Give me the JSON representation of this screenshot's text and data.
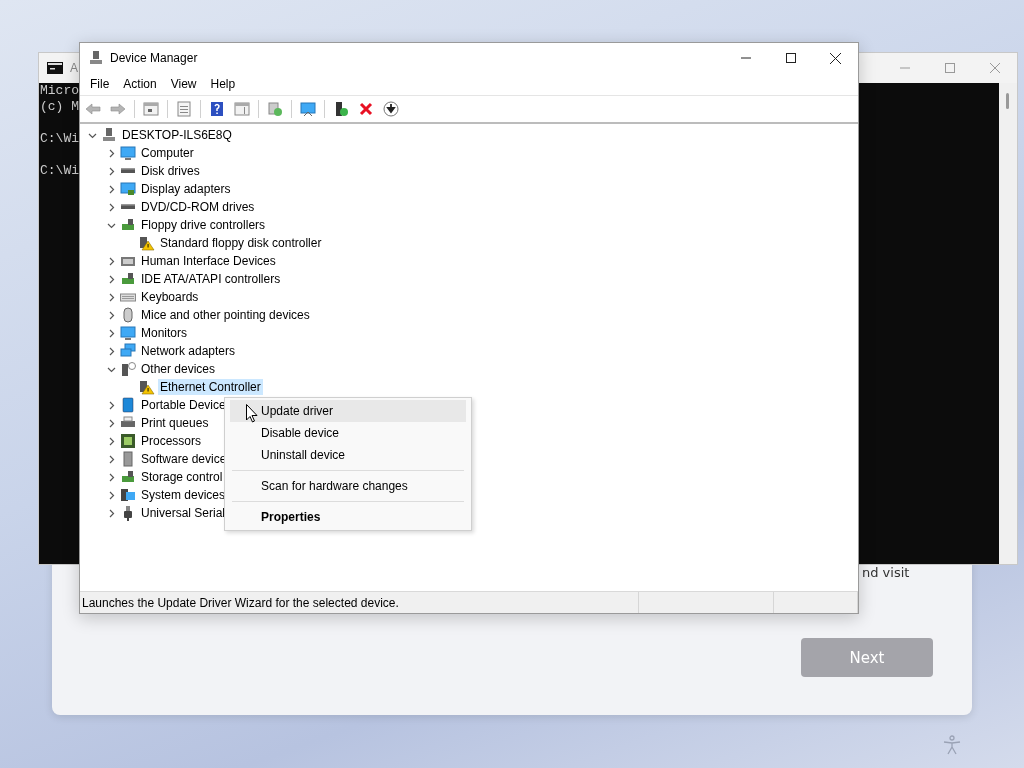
{
  "setup_dialog": {
    "visible_text": "nd visit",
    "next_button": {
      "label": "Next",
      "disabled": true
    }
  },
  "console_window": {
    "title": "A",
    "blocks": [
      [
        "Micro",
        "(c) M"
      ],
      [
        "C:\\Wi"
      ],
      [
        "C:\\Wi"
      ]
    ]
  },
  "device_manager": {
    "title": "Device Manager",
    "menu": [
      "File",
      "Action",
      "View",
      "Help"
    ],
    "tree": {
      "label": "DESKTOP-ILS6E8Q",
      "kind": "computer-root",
      "expanded": true,
      "selected": false,
      "children": [
        {
          "label": "Computer",
          "kind": "monitor",
          "expanded": false,
          "selected": false
        },
        {
          "label": "Disk drives",
          "kind": "drive",
          "expanded": false,
          "selected": false
        },
        {
          "label": "Display adapters",
          "kind": "display",
          "expanded": false,
          "selected": false
        },
        {
          "label": "DVD/CD-ROM drives",
          "kind": "drive",
          "expanded": false,
          "selected": false
        },
        {
          "label": "Floppy drive controllers",
          "kind": "controller",
          "expanded": true,
          "selected": false,
          "children": [
            {
              "label": "Standard floppy disk controller",
              "kind": "warning",
              "selected": false
            }
          ]
        },
        {
          "label": "Human Interface Devices",
          "kind": "hid",
          "expanded": false,
          "selected": false
        },
        {
          "label": "IDE ATA/ATAPI controllers",
          "kind": "controller",
          "expanded": false,
          "selected": false
        },
        {
          "label": "Keyboards",
          "kind": "keyboard",
          "expanded": false,
          "selected": false
        },
        {
          "label": "Mice and other pointing devices",
          "kind": "mouse",
          "expanded": false,
          "selected": false
        },
        {
          "label": "Monitors",
          "kind": "monitor",
          "expanded": false,
          "selected": false
        },
        {
          "label": "Network adapters",
          "kind": "network",
          "expanded": false,
          "selected": false
        },
        {
          "label": "Other devices",
          "kind": "unknown",
          "expanded": true,
          "selected": false,
          "children": [
            {
              "label": "Ethernet Controller",
              "kind": "warning",
              "selected": true
            }
          ]
        },
        {
          "label": "Portable Device",
          "kind": "portable",
          "expanded": false,
          "selected": false
        },
        {
          "label": "Print queues",
          "kind": "printer",
          "expanded": false,
          "selected": false
        },
        {
          "label": "Processors",
          "kind": "chip",
          "expanded": false,
          "selected": false
        },
        {
          "label": "Software device",
          "kind": "software",
          "expanded": false,
          "selected": false
        },
        {
          "label": "Storage control",
          "kind": "controller",
          "expanded": false,
          "selected": false
        },
        {
          "label": "System devices",
          "kind": "system",
          "expanded": false,
          "selected": false
        },
        {
          "label": "Universal Serial",
          "kind": "usb",
          "expanded": false,
          "selected": false
        }
      ]
    },
    "status_bar": [
      "Launches the Update Driver Wizard for the selected device."
    ]
  },
  "context_menu": [
    {
      "kind": "item",
      "label": "Update driver",
      "selected": true
    },
    {
      "kind": "item",
      "label": "Disable device",
      "selected": false
    },
    {
      "kind": "item",
      "label": "Uninstall device",
      "selected": false
    },
    {
      "kind": "separator"
    },
    {
      "kind": "item",
      "label": "Scan for hardware changes",
      "selected": false
    },
    {
      "kind": "separator"
    },
    {
      "kind": "item",
      "label": "Properties",
      "selected": false,
      "default": true
    }
  ]
}
